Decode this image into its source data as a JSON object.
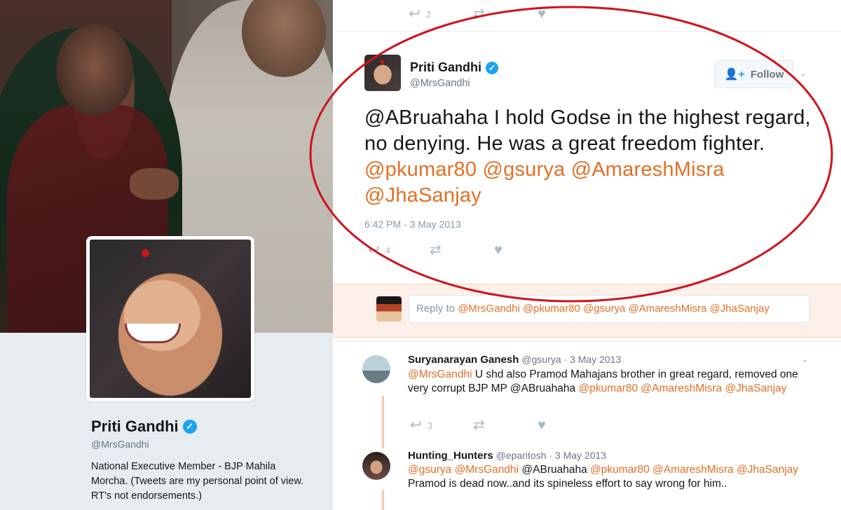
{
  "profile": {
    "name": "Priti Gandhi",
    "handle": "@MrsGandhi",
    "bio": "National Executive Member - BJP Mahila Morcha. (Tweets are my personal point of view. RT's not endorsements.)"
  },
  "top_actions": {
    "reply_count": "2"
  },
  "tweet": {
    "author_name": "Priti Gandhi",
    "author_handle": "@MrsGandhi",
    "follow_label": "Follow",
    "text_parts": {
      "mention_first": "@ABruahaha",
      "body": " I hold Godse in the highest regard, no denying. He was a great freedom fighter. ",
      "mention_2": "@pkumar80",
      "mention_3": "@gsurya",
      "mention_4": "@AmareshMisra",
      "mention_5": "@JhaSanjay"
    },
    "timestamp": "6:42 PM - 3 May 2013",
    "reply_count": "4"
  },
  "reply_box": {
    "prefix": "Reply to ",
    "mentions": "@MrsGandhi @pkumar80 @gsurya @AmareshMisra @JhaSanjay"
  },
  "replies": [
    {
      "name": "Suryanarayan Ganesh",
      "meta": "@gsurya · 3 May 2013",
      "mention_lead": "@MrsGandhi",
      "text_mid": " U shd also Pramod Mahajans brother in great regard, removed one very corrupt BJP MP @ABruahaha ",
      "mention_tail": "@pkumar80 @AmareshMisra @JhaSanjay",
      "reply_count": "3"
    },
    {
      "name": "Hunting_Hunters",
      "meta": "@eparitosh · 3 May 2013",
      "mention_lead": "@gsurya @MrsGandhi",
      "text_mid": " @ABruahaha ",
      "mention_mid": "@pkumar80 @AmareshMisra @JhaSanjay",
      "text_tail": " Pramod is dead now..and its spineless effort to say wrong for him.."
    }
  ],
  "colors": {
    "mention": "#e46f25",
    "verified": "#1da1f2",
    "annotation_circle": "#d0121b",
    "reply_bg": "#fdf0e8"
  },
  "icons": [
    "reply-icon",
    "retweet-icon",
    "like-icon",
    "follow-person-icon",
    "chevron-down-icon",
    "verified-badge-icon"
  ]
}
